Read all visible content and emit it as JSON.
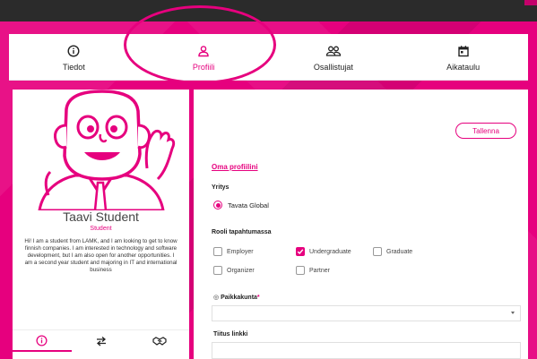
{
  "tabs": [
    {
      "label": "Tiedot",
      "icon": "info-circle-icon",
      "active": false
    },
    {
      "label": "Profiili",
      "icon": "user-icon",
      "active": true
    },
    {
      "label": "Osallistujat",
      "icon": "users-icon",
      "active": false
    },
    {
      "label": "Aikataulu",
      "icon": "calendar-icon",
      "active": false
    }
  ],
  "profile": {
    "name": "Taavi Student",
    "role": "Student",
    "bio": "Hi! I am a student from LAMK, and I am looking to get to know finnish companies. I am interested in technology and software development, but I am also open for another opportunities. I am a second year student and majoring in IT and international business"
  },
  "card_tabs": [
    "info-circle-icon",
    "swap-arrows-icon",
    "handshake-icon"
  ],
  "form": {
    "save_label": "Tallenna",
    "section_title": "Oma profiilini",
    "company_label": "Yritys",
    "company_value": "Tavata Global",
    "role_label": "Rooli tapahtumassa",
    "roles": [
      {
        "label": "Employer",
        "checked": false
      },
      {
        "label": "Undergraduate",
        "checked": true
      },
      {
        "label": "Graduate",
        "checked": false
      },
      {
        "label": "Organizer",
        "checked": false
      },
      {
        "label": "Partner",
        "checked": false
      }
    ],
    "city_label": "Paikkakunta",
    "city_required": "*",
    "city_value": "",
    "link_label": "Tiitus linkki",
    "link_value": ""
  },
  "colors": {
    "accent": "#e6007e",
    "header": "#2b2b2b"
  }
}
